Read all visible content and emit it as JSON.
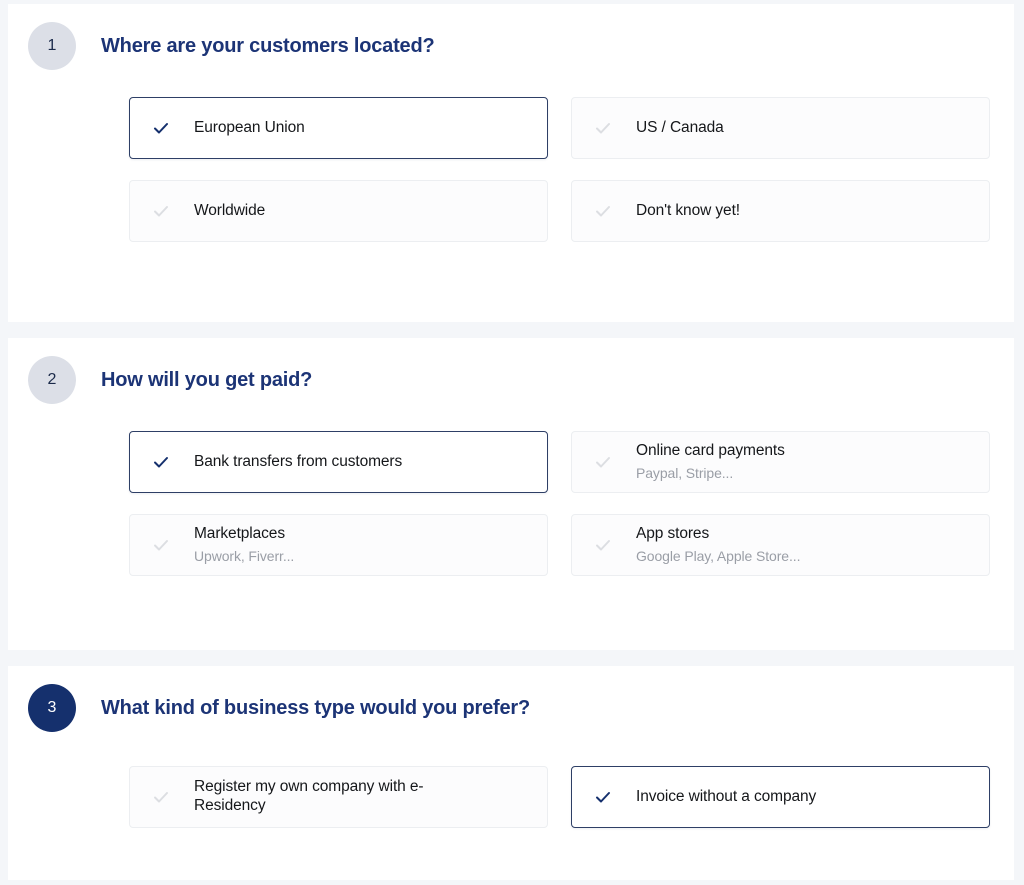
{
  "theme": {
    "page_background": "#f4f6f9",
    "panel_background": "#ffffff",
    "heading_color": "#1c3476",
    "badge_active_background": "#15306d",
    "badge_inactive_background": "#dcdfe7",
    "selected_border_color": "#2e3f66",
    "checkmark_selected_color": "#15306d",
    "checkmark_unselected_color": "#dcdee2",
    "option_title_color": "#15171a",
    "option_subtitle_color": "#9a9ea6"
  },
  "steps": [
    {
      "number": "1",
      "state": "inactive",
      "title": "Where are your customers located?",
      "options": [
        {
          "title": "European Union",
          "subtitle": "",
          "selected": true,
          "check_icon": "check-icon"
        },
        {
          "title": "US / Canada",
          "subtitle": "",
          "selected": false,
          "check_icon": "check-icon"
        },
        {
          "title": "Worldwide",
          "subtitle": "",
          "selected": false,
          "check_icon": "check-icon"
        },
        {
          "title": "Don't know yet!",
          "subtitle": "",
          "selected": false,
          "check_icon": "check-icon"
        }
      ]
    },
    {
      "number": "2",
      "state": "inactive",
      "title": "How will you get paid?",
      "options": [
        {
          "title": "Bank transfers from customers",
          "subtitle": "",
          "selected": true,
          "check_icon": "check-icon"
        },
        {
          "title": "Online card payments",
          "subtitle": "Paypal, Stripe...",
          "selected": false,
          "check_icon": "check-icon"
        },
        {
          "title": "Marketplaces",
          "subtitle": "Upwork, Fiverr...",
          "selected": false,
          "check_icon": "check-icon"
        },
        {
          "title": "App stores",
          "subtitle": "Google Play, Apple Store...",
          "selected": false,
          "check_icon": "check-icon"
        }
      ]
    },
    {
      "number": "3",
      "state": "active",
      "title": "What kind of business type would you prefer?",
      "options": [
        {
          "title": "Register my own company with e-Residency",
          "subtitle": "",
          "selected": false,
          "check_icon": "check-icon"
        },
        {
          "title": "Invoice without a company",
          "subtitle": "",
          "selected": true,
          "check_icon": "check-icon"
        }
      ]
    }
  ]
}
